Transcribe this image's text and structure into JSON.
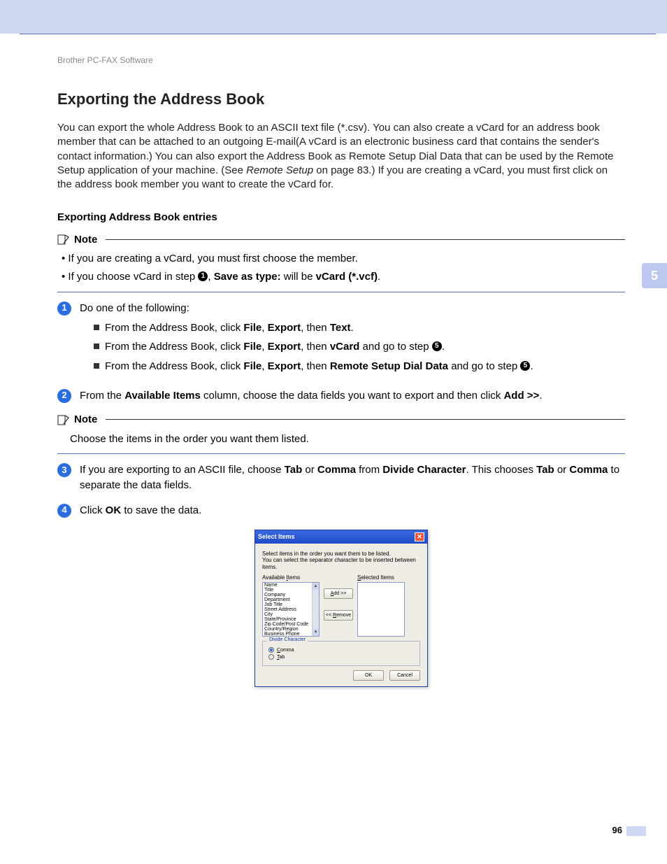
{
  "breadcrumb": "Brother PC-FAX Software",
  "heading": "Exporting the Address Book",
  "intro_parts": {
    "p1": "You can export the whole Address Book to an ASCII text file (*.csv). You can also create a vCard for an address book member that can be attached to an outgoing E-mail(A vCard is an electronic business card that contains the sender's contact information.) You can also export the Address Book as Remote Setup Dial Data that can be used by the Remote Setup application of your machine. (See ",
    "ref": "Remote Setup",
    "p2": " on page 83.) If you are creating a vCard, you must first click on the address book member you want to create the vCard for."
  },
  "subheading": "Exporting Address Book entries",
  "note_label": "Note",
  "note1": {
    "li1": "If you are creating a vCard, you must first choose the member.",
    "li2a": "If you choose vCard in step ",
    "li2b": ", ",
    "li2_save": "Save as type:",
    "li2c": " will be ",
    "li2_vcf": "vCard (*.vcf)",
    "li2d": "."
  },
  "step1": {
    "lead": "Do one of the following:",
    "a_pre": "From the Address Book, click ",
    "a_file": "File",
    "a_c1": ", ",
    "a_export": "Export",
    "a_c2": ", then ",
    "a_text": "Text",
    "a_end": ".",
    "b_pre": "From the Address Book, click ",
    "b_file": "File",
    "b_c1": ", ",
    "b_export": "Export",
    "b_c2": ", then ",
    "b_vcard": "vCard",
    "b_c3": " and go to step ",
    "b_end": ".",
    "c_pre": "From the Address Book, click ",
    "c_file": "File",
    "c_c1": ", ",
    "c_export": "Export",
    "c_c2": ", then ",
    "c_rs": "Remote Setup Dial Data",
    "c_c3": " and go to step ",
    "c_end": "."
  },
  "step2": {
    "a": "From the ",
    "avail": "Available Items",
    "b": " column, choose the data fields you want to export and then click ",
    "add": "Add >>",
    "c": "."
  },
  "note2": "Choose the items in the order you want them listed.",
  "step3": {
    "a": "If you are exporting to an ASCII file, choose ",
    "tab": "Tab",
    "b": " or ",
    "comma": "Comma",
    "c": " from ",
    "div": "Divide Character",
    "d": ". This chooses ",
    "tab2": "Tab",
    "e": " or ",
    "comma2": "Comma",
    "f": " to separate the data fields."
  },
  "step4": {
    "a": "Click ",
    "ok": "OK",
    "b": " to save the data."
  },
  "side_tab": "5",
  "page_number": "96",
  "circles": {
    "one": "1",
    "two": "2",
    "three": "3",
    "four": "4",
    "five": "5"
  },
  "dialog": {
    "title": "Select Items",
    "desc1": "Select items in the order you want them to be listed.",
    "desc2": "You can select the separator character to be inserted between items.",
    "available_label_a": "Available ",
    "available_label_u": "I",
    "available_label_b": "tems",
    "selected_label_u": "S",
    "selected_label_b": "elected Items",
    "items": [
      "Name",
      "Title",
      "Company",
      "Department",
      "Job Title",
      "Street Address",
      "City",
      "State/Province",
      "Zip Code/Post Code",
      "Country/Region",
      "Business Phone"
    ],
    "add_u": "A",
    "add_rest": "dd >>",
    "rem_pre": "<< ",
    "rem_u": "R",
    "rem_rest": "emove",
    "legend": "Divide Character",
    "radio_comma_u": "C",
    "radio_comma_rest": "omma",
    "radio_tab_u": "T",
    "radio_tab_rest": "ab",
    "ok": "OK",
    "cancel": "Cancel"
  }
}
